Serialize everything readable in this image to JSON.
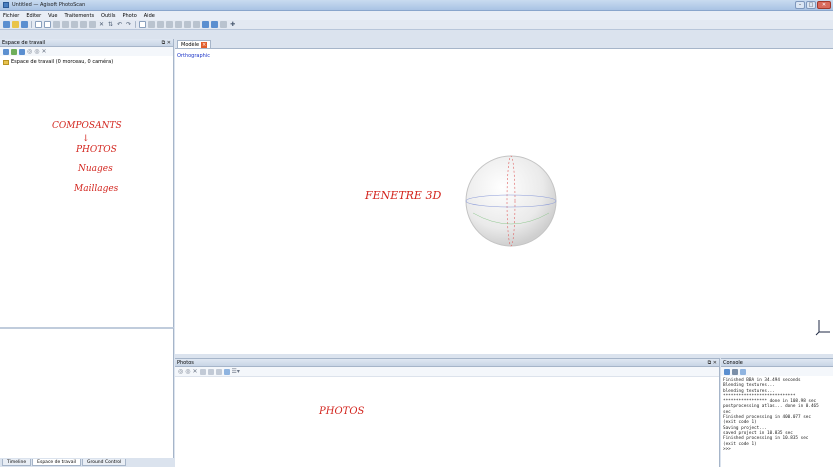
{
  "window": {
    "title": "Untitled — Agisoft PhotoScan"
  },
  "menu": [
    "Fichier",
    "Editer",
    "Vue",
    "Traitements",
    "Outils",
    "Photo",
    "Aide"
  ],
  "workspace": {
    "title": "Espace de travail",
    "tree_item": "Espace de travail (0 morceau, 0 caméra)",
    "annotation": [
      "COMPOSANTS",
      "↓",
      "PHOTOS",
      "Nuages",
      "Maillages"
    ]
  },
  "bottom_tabs": [
    "Timeline",
    "Espace de travail",
    "Ground Control"
  ],
  "model": {
    "tab_label": "Modèle",
    "projection": "Orthographic",
    "annotation": "FENETRE 3D"
  },
  "photos": {
    "title": "Photos",
    "annotation": "PHOTOS"
  },
  "console": {
    "title": "Console",
    "lines": [
      "Finished BBA in 34.494 seconds",
      "Blending textures...",
      "blending textures...",
      "****************************",
      "***************** done in 108.98 sec",
      "postprocessing atlas... done in 0.465",
      "sec",
      "Finished processing in 400.077 sec",
      "(exit code 1)",
      "Saving project...",
      "saved project in 10.835 sec",
      "Finished processing in 10.835 sec",
      "(exit code 1)",
      ">>>"
    ]
  },
  "colors": {
    "annotation": "#d3261f",
    "projection_label": "#1a33c8",
    "model_tab_close": "#e25d2c"
  }
}
